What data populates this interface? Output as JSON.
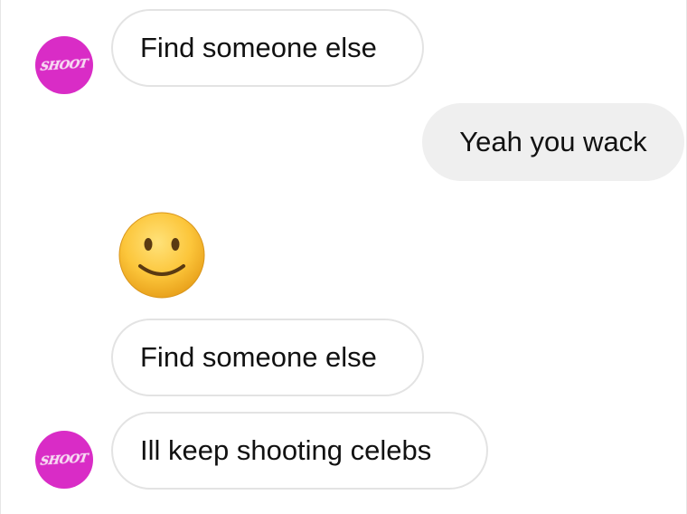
{
  "contact": {
    "avatar_text": "SHOOT",
    "avatar_color": "#d92cc6"
  },
  "messages": [
    {
      "sender": "them",
      "type": "text",
      "text": "Find someone else"
    },
    {
      "sender": "me",
      "type": "text",
      "text": "Yeah you wack"
    },
    {
      "sender": "them",
      "type": "emoji",
      "emoji": "slightly-smiling-face"
    },
    {
      "sender": "them",
      "type": "text",
      "text": "Find someone else"
    },
    {
      "sender": "them",
      "type": "text",
      "text": "Ill keep shooting celebs"
    }
  ]
}
